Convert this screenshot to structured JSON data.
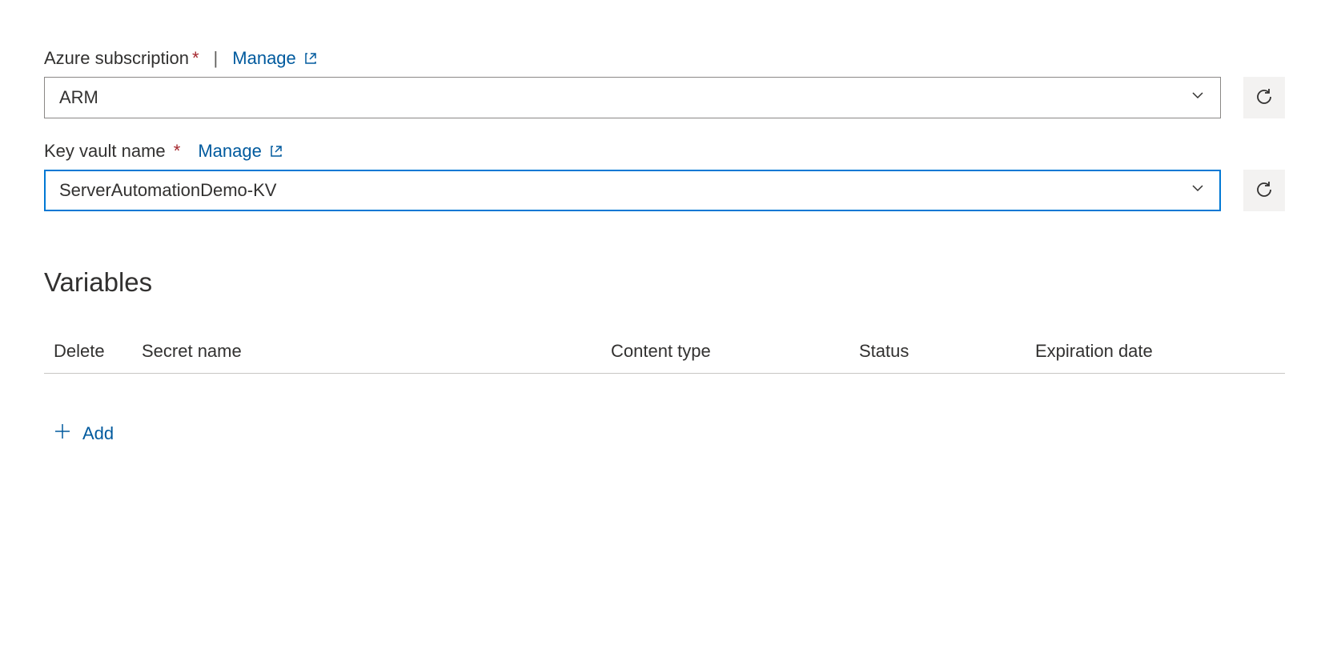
{
  "subscription": {
    "label": "Azure subscription",
    "required": "*",
    "manage": "Manage",
    "value": "ARM"
  },
  "keyvault": {
    "label": "Key vault name",
    "required": "*",
    "manage": "Manage",
    "value": "ServerAutomationDemo-KV"
  },
  "variables": {
    "heading": "Variables",
    "columns": {
      "delete": "Delete",
      "secret_name": "Secret name",
      "content_type": "Content type",
      "status": "Status",
      "expiration": "Expiration date"
    },
    "add_label": "Add"
  }
}
